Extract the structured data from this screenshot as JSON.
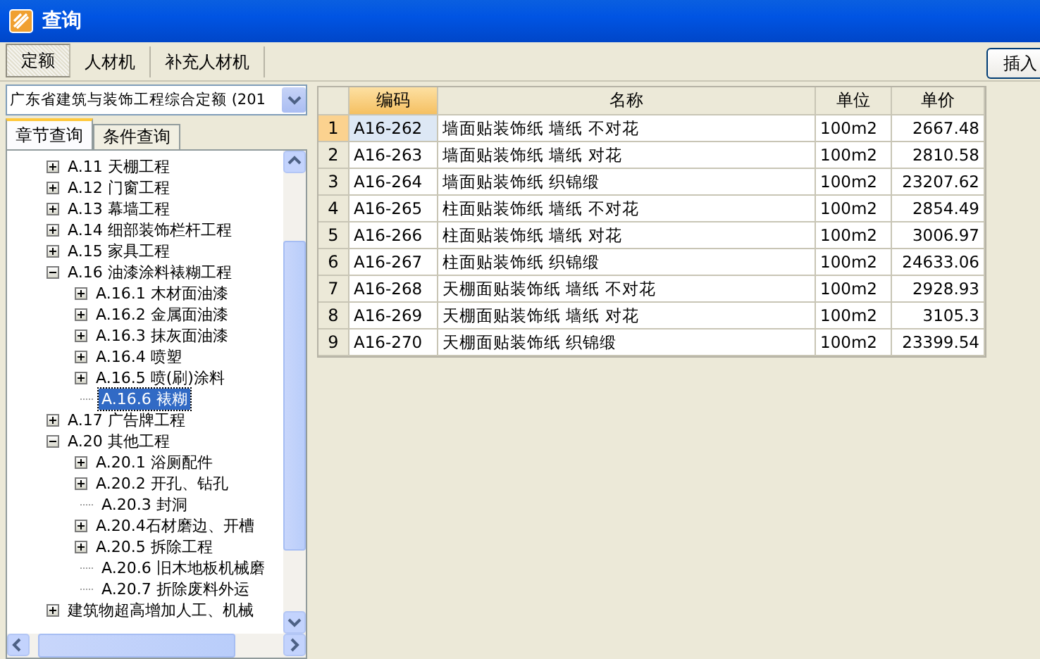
{
  "window": {
    "title": "查询"
  },
  "tabs": [
    {
      "label": "定额",
      "selected": true
    },
    {
      "label": "人材机",
      "selected": false
    },
    {
      "label": "补充人材机",
      "selected": false
    }
  ],
  "insert_button": "插入",
  "quota_select": {
    "value": "广东省建筑与装饰工程综合定额 (201"
  },
  "sub_tabs": [
    {
      "label": "章节查询",
      "selected": true
    },
    {
      "label": "条件查询",
      "selected": false
    }
  ],
  "tree": [
    {
      "label": "A.11 天棚工程",
      "kind": "node",
      "expanded": false,
      "selected": false
    },
    {
      "label": "A.12 门窗工程",
      "kind": "node",
      "expanded": false,
      "selected": false
    },
    {
      "label": "A.13 幕墙工程",
      "kind": "node",
      "expanded": false,
      "selected": false
    },
    {
      "label": "A.14 细部装饰栏杆工程",
      "kind": "node",
      "expanded": false,
      "selected": false
    },
    {
      "label": "A.15 家具工程",
      "kind": "node",
      "expanded": false,
      "selected": false
    },
    {
      "label": "A.16 油漆涂料裱糊工程",
      "kind": "node",
      "expanded": true,
      "selected": false,
      "children": [
        {
          "label": "A.16.1 木材面油漆",
          "kind": "node",
          "expanded": false,
          "selected": false
        },
        {
          "label": "A.16.2 金属面油漆",
          "kind": "node",
          "expanded": false,
          "selected": false
        },
        {
          "label": "A.16.3 抹灰面油漆",
          "kind": "node",
          "expanded": false,
          "selected": false
        },
        {
          "label": "A.16.4 喷塑",
          "kind": "node",
          "expanded": false,
          "selected": false
        },
        {
          "label": "A.16.5 喷(刷)涂料",
          "kind": "node",
          "expanded": false,
          "selected": false
        },
        {
          "label": "A.16.6 裱糊",
          "kind": "leaf",
          "selected": true
        }
      ]
    },
    {
      "label": "A.17 广告牌工程",
      "kind": "node",
      "expanded": false,
      "selected": false
    },
    {
      "label": "A.20 其他工程",
      "kind": "node",
      "expanded": true,
      "selected": false,
      "children": [
        {
          "label": "A.20.1 浴厕配件",
          "kind": "node",
          "expanded": false,
          "selected": false
        },
        {
          "label": "A.20.2 开孔、钻孔",
          "kind": "node",
          "expanded": false,
          "selected": false
        },
        {
          "label": "A.20.3 封洞",
          "kind": "leaf",
          "selected": false
        },
        {
          "label": "A.20.4石材磨边、开槽",
          "kind": "node",
          "expanded": false,
          "selected": false
        },
        {
          "label": "A.20.5 拆除工程",
          "kind": "node",
          "expanded": false,
          "selected": false
        },
        {
          "label": "A.20.6 旧木地板机械磨",
          "kind": "leaf",
          "selected": false
        },
        {
          "label": "A.20.7 折除废料外运",
          "kind": "leaf",
          "selected": false
        }
      ]
    },
    {
      "label": "建筑物超高增加人工、机械",
      "kind": "node",
      "expanded": false,
      "selected": false
    }
  ],
  "table": {
    "columns": [
      {
        "label": "编码",
        "selected": true
      },
      {
        "label": "名称",
        "selected": false
      },
      {
        "label": "单位",
        "selected": false
      },
      {
        "label": "单价",
        "selected": false
      }
    ],
    "rows": [
      {
        "num": "1",
        "selected": true,
        "cells": [
          "A16-262",
          "墙面贴装饰纸 墙纸 不对花",
          "100m2",
          "2667.48"
        ]
      },
      {
        "num": "2",
        "selected": false,
        "cells": [
          "A16-263",
          "墙面贴装饰纸 墙纸 对花",
          "100m2",
          "2810.58"
        ]
      },
      {
        "num": "3",
        "selected": false,
        "cells": [
          "A16-264",
          "墙面贴装饰纸 织锦缎",
          "100m2",
          "23207.62"
        ]
      },
      {
        "num": "4",
        "selected": false,
        "cells": [
          "A16-265",
          "柱面贴装饰纸 墙纸 不对花",
          "100m2",
          "2854.49"
        ]
      },
      {
        "num": "5",
        "selected": false,
        "cells": [
          "A16-266",
          "柱面贴装饰纸 墙纸 对花",
          "100m2",
          "3006.97"
        ]
      },
      {
        "num": "6",
        "selected": false,
        "cells": [
          "A16-267",
          "柱面贴装饰纸 织锦缎",
          "100m2",
          "24633.06"
        ]
      },
      {
        "num": "7",
        "selected": false,
        "cells": [
          "A16-268",
          "天棚面贴装饰纸 墙纸 不对花",
          "100m2",
          "2928.93"
        ]
      },
      {
        "num": "8",
        "selected": false,
        "cells": [
          "A16-269",
          "天棚面贴装饰纸 墙纸 对花",
          "100m2",
          "3105.3"
        ]
      },
      {
        "num": "9",
        "selected": false,
        "cells": [
          "A16-270",
          "天棚面贴装饰纸 织锦缎",
          "100m2",
          "23399.54"
        ]
      }
    ]
  }
}
